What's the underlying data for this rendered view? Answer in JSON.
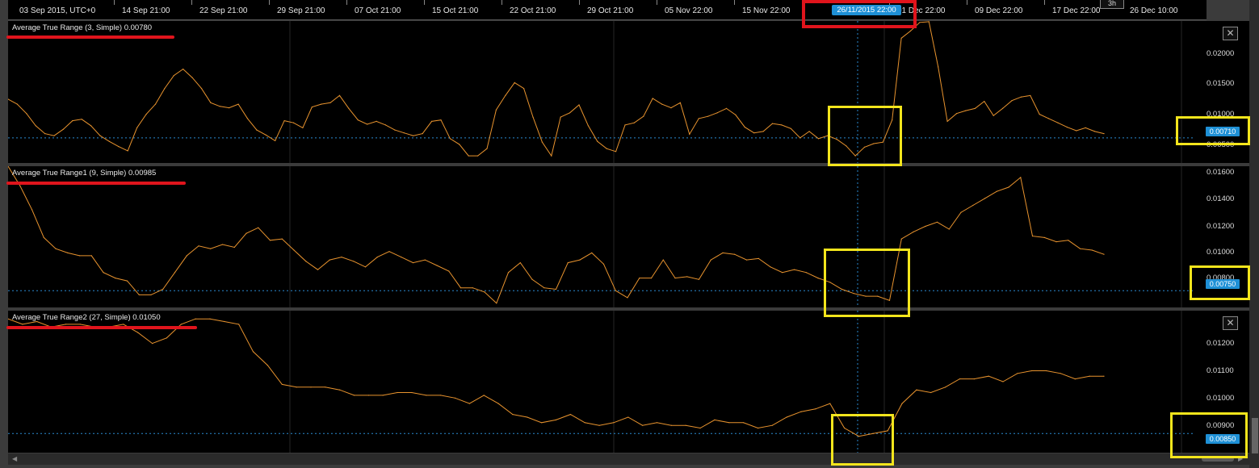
{
  "time_axis": {
    "labels": [
      "03 Sep 2015, UTC+0",
      "14 Sep 21:00",
      "22 Sep 21:00",
      "29 Sep 21:00",
      "07 Oct 21:00",
      "15 Oct 21:00",
      "22 Oct 21:00",
      "29 Oct 21:00",
      "05 Nov 22:00",
      "15 Nov 22:00",
      "01 Dec 22:00",
      "09 Dec 22:00",
      "17 Dec 22:00",
      "26 Dec 10:00"
    ],
    "crosshair_label": "26/11/2015 22:00",
    "period": "3h"
  },
  "colors": {
    "line": "#e8932e",
    "level": "#2a8ad0",
    "tag": "#1e90d6",
    "annotation_red": "#e0141c",
    "annotation_yellow": "#f3e51c"
  },
  "icons": {
    "close": "close-icon",
    "scroll_left": "triangle-left-icon",
    "scroll_right": "triangle-right-icon"
  },
  "panels": [
    {
      "title": "Average True Range (3, Simple) 0.00780",
      "current_value_label": "0.00710",
      "y_labels": [
        "0.02000",
        "0.01500",
        "0.01000",
        "0.00500"
      ]
    },
    {
      "title": "Average True Range1 (9, Simple) 0.00985",
      "current_value_label": "0.00750",
      "y_labels": [
        "0.01600",
        "0.01400",
        "0.01200",
        "0.01000",
        "0.00800"
      ]
    },
    {
      "title": "Average True Range2 (27, Simple) 0.01050",
      "current_value_label": "0.00850",
      "y_labels": [
        "0.01200",
        "0.01100",
        "0.01000",
        "0.00900"
      ]
    }
  ],
  "chart_data": [
    {
      "type": "line",
      "title": "Average True Range (3, Simple) 0.00780",
      "ylim": [
        0.0036,
        0.0234
      ],
      "level": 0.0071,
      "series": [
        {
          "values": [
            0.0125,
            0.0118,
            0.0105,
            0.0088,
            0.0077,
            0.0074,
            0.0083,
            0.0095,
            0.0097,
            0.0088,
            0.0074,
            0.0066,
            0.0059,
            0.0053,
            0.0085,
            0.0104,
            0.0118,
            0.014,
            0.0158,
            0.0167,
            0.0155,
            0.014,
            0.012,
            0.0115,
            0.0113,
            0.0118,
            0.0098,
            0.0082,
            0.0075,
            0.0067,
            0.0095,
            0.0092,
            0.0085,
            0.0114,
            0.0118,
            0.012,
            0.013,
            0.0112,
            0.0096,
            0.009,
            0.0094,
            0.0089,
            0.0082,
            0.0078,
            0.0074,
            0.0077,
            0.0094,
            0.0096,
            0.007,
            0.0062,
            0.0046,
            0.0046,
            0.0056,
            0.011,
            0.013,
            0.0148,
            0.014,
            0.01,
            0.0065,
            0.0046,
            0.01,
            0.0106,
            0.0117,
            0.0088,
            0.0066,
            0.0056,
            0.0052,
            0.0089,
            0.0092,
            0.0101,
            0.0126,
            0.0118,
            0.0113,
            0.012,
            0.0076,
            0.0098,
            0.0101,
            0.0106,
            0.0112,
            0.0103,
            0.0086,
            0.0078,
            0.008,
            0.0091,
            0.0089,
            0.0084,
            0.0071,
            0.008,
            0.007,
            0.0074,
            0.0069,
            0.006,
            0.0046,
            0.0058,
            0.0063,
            0.0065,
            0.0096,
            0.021,
            0.022,
            0.0232,
            0.0233,
            0.017,
            0.0094,
            0.0105,
            0.0109,
            0.0112,
            0.0122,
            0.0102,
            0.0112,
            0.0123,
            0.0128,
            0.013,
            0.0104,
            0.0098,
            0.0092,
            0.0086,
            0.0081,
            0.0085,
            0.008,
            0.0077
          ]
        }
      ]
    },
    {
      "type": "line",
      "title": "Average True Range1 (9, Simple) 0.00985",
      "ylim": [
        0.0063,
        0.0164
      ],
      "level": 0.0075,
      "series": [
        {
          "values": [
            0.0164,
            0.015,
            0.0133,
            0.0113,
            0.0105,
            0.0102,
            0.01,
            0.01,
            0.0088,
            0.0084,
            0.0082,
            0.0072,
            0.0072,
            0.0076,
            0.0088,
            0.01,
            0.0107,
            0.0105,
            0.0108,
            0.0106,
            0.0116,
            0.012,
            0.0111,
            0.0112,
            0.0104,
            0.0096,
            0.009,
            0.0097,
            0.0099,
            0.0096,
            0.0092,
            0.0099,
            0.0103,
            0.0099,
            0.0095,
            0.0097,
            0.0093,
            0.0089,
            0.0077,
            0.0077,
            0.0074,
            0.0066,
            0.0088,
            0.0095,
            0.0083,
            0.0077,
            0.0076,
            0.0095,
            0.0097,
            0.0102,
            0.0094,
            0.0075,
            0.007,
            0.0084,
            0.0084,
            0.0097,
            0.0084,
            0.0085,
            0.0083,
            0.0097,
            0.0102,
            0.0101,
            0.0097,
            0.0098,
            0.0092,
            0.0088,
            0.009,
            0.0088,
            0.0084,
            0.0081,
            0.0076,
            0.0073,
            0.0071,
            0.0071,
            0.0068,
            0.0112,
            0.0117,
            0.0121,
            0.0124,
            0.0119,
            0.0131,
            0.0136,
            0.0141,
            0.0146,
            0.0149,
            0.0156,
            0.0114,
            0.0113,
            0.011,
            0.0111,
            0.0105,
            0.0104,
            0.0101
          ]
        }
      ]
    },
    {
      "type": "line",
      "title": "Average True Range2 (27, Simple) 0.01050",
      "ylim": [
        0.0078,
        0.013
      ],
      "level": 0.0085,
      "series": [
        {
          "values": [
            0.0127,
            0.0125,
            0.0126,
            0.0124,
            0.0125,
            0.0125,
            0.0124,
            0.0124,
            0.0125,
            0.0122,
            0.0118,
            0.012,
            0.0125,
            0.0127,
            0.0127,
            0.0126,
            0.0125,
            0.0115,
            0.011,
            0.0103,
            0.0102,
            0.0102,
            0.0102,
            0.0101,
            0.0099,
            0.0099,
            0.0099,
            0.01,
            0.01,
            0.0099,
            0.0099,
            0.0098,
            0.0096,
            0.0099,
            0.0096,
            0.0092,
            0.0091,
            0.0089,
            0.009,
            0.0092,
            0.0089,
            0.0088,
            0.0089,
            0.0091,
            0.0088,
            0.0089,
            0.0088,
            0.0088,
            0.0087,
            0.009,
            0.0089,
            0.0089,
            0.0087,
            0.0088,
            0.0091,
            0.0093,
            0.0094,
            0.0096,
            0.0087,
            0.0084,
            0.0085,
            0.0086,
            0.0096,
            0.0101,
            0.01,
            0.0102,
            0.0105,
            0.0105,
            0.0106,
            0.0104,
            0.0107,
            0.0108,
            0.0108,
            0.0107,
            0.0105,
            0.0106,
            0.0106
          ]
        }
      ]
    }
  ]
}
